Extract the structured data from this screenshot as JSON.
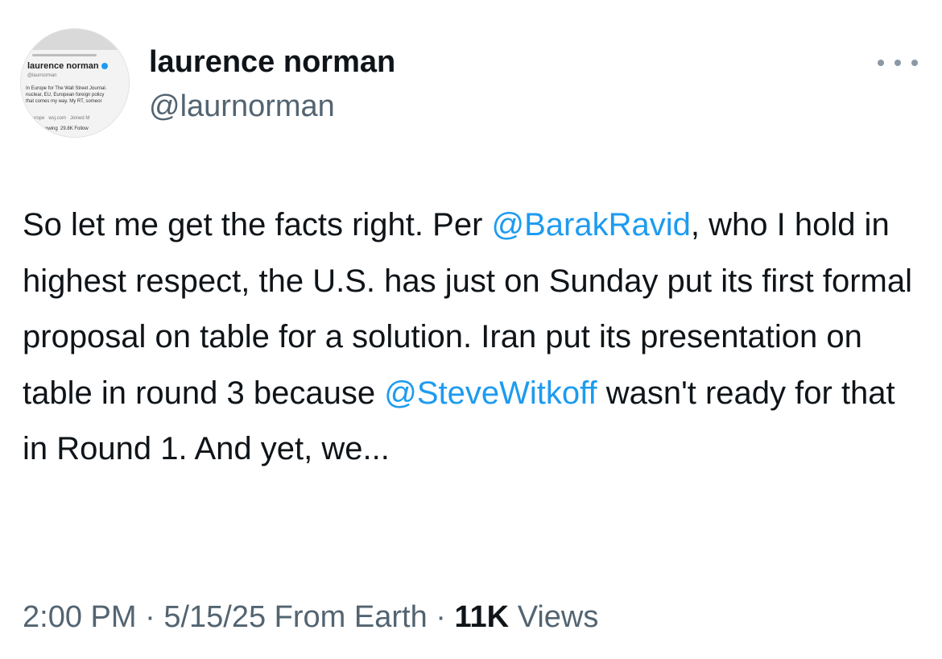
{
  "author": {
    "display_name": "laurence norman",
    "handle": "@laurnorman",
    "avatar": {
      "name": "laurence norman",
      "handle": "@laurnorman",
      "bio": "In Europe for The Wall Street Journal.\nnuclear, EU, European foreign policy\nthat comes my way. My RT, someor",
      "meta": "Europe   wsj.com   Joined M",
      "follow": "owing  29.8K Follow"
    }
  },
  "more_icon": "more-horizontal-icon",
  "tweet": {
    "segments": [
      {
        "text": "So let me get the facts right. Per ",
        "type": "text"
      },
      {
        "text": "@BarakRavid",
        "type": "mention"
      },
      {
        "text": ", who I hold in highest respect, the U.S. has just on Sunday put its first formal proposal on table for a solution. Iran put its presentation on table in round 3 because ",
        "type": "text"
      },
      {
        "text": "@SteveWitkoff",
        "type": "mention"
      },
      {
        "text": " wasn't ready for that in Round 1. And yet, we...",
        "type": "text"
      }
    ]
  },
  "meta": {
    "time": "2:00 PM",
    "separator": "·",
    "date": "5/15/25",
    "source": "From Earth",
    "views_count": "11K",
    "views_label": "Views"
  },
  "colors": {
    "link": "#1d9bf0",
    "text": "#0f1419",
    "secondary": "#536471"
  }
}
